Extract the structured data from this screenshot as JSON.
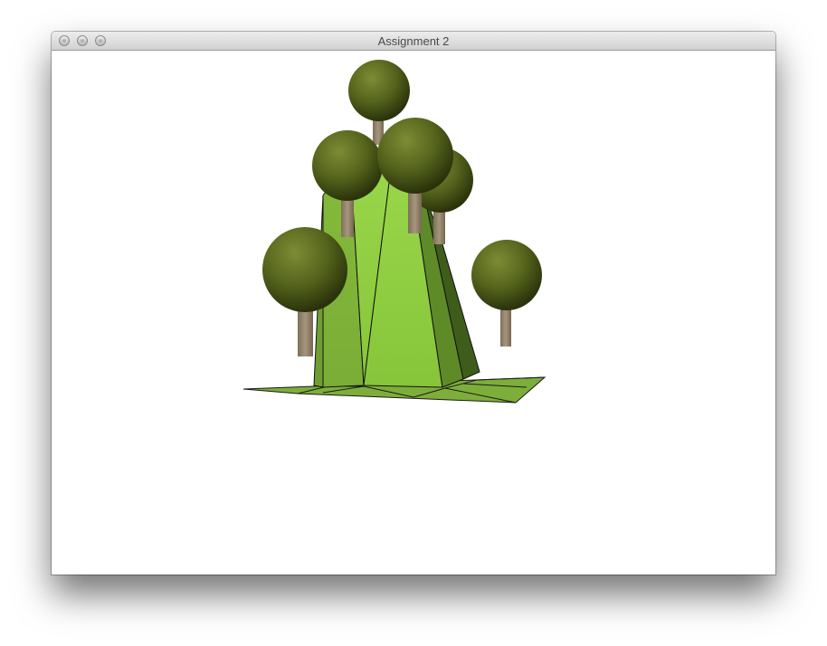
{
  "window": {
    "title": "Assignment 2",
    "controls": [
      "close-icon",
      "minimize-icon",
      "zoom-icon"
    ]
  },
  "scene": {
    "terrain_colors": {
      "light": "#8fcf3a",
      "mid": "#7fb03a",
      "dark": "#4a6b1f",
      "edge": "#111111"
    },
    "tree_colors": {
      "foliage_light": "#7a8a30",
      "foliage_dark": "#2f3a0d",
      "trunk": "#9a8a72"
    },
    "tree_count": 6
  }
}
